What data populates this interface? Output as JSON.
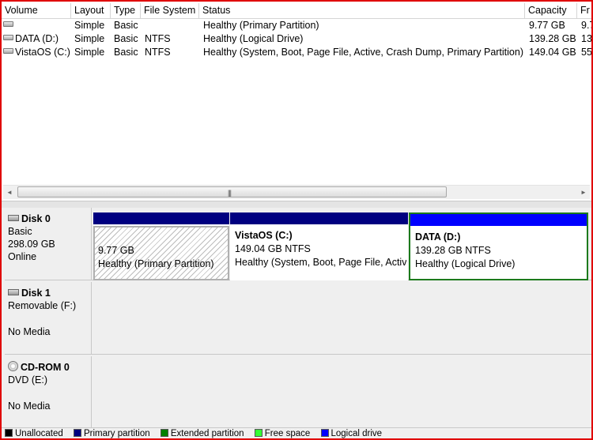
{
  "columns": [
    "Volume",
    "Layout",
    "Type",
    "File System",
    "Status",
    "Capacity",
    "Fr"
  ],
  "volumes": [
    {
      "name": "",
      "layout": "Simple",
      "type": "Basic",
      "fs": "",
      "status": "Healthy (Primary Partition)",
      "capacity": "9.77 GB",
      "free": "9.7"
    },
    {
      "name": "DATA (D:)",
      "layout": "Simple",
      "type": "Basic",
      "fs": "NTFS",
      "status": "Healthy (Logical Drive)",
      "capacity": "139.28 GB",
      "free": "13"
    },
    {
      "name": "VistaOS (C:)",
      "layout": "Simple",
      "type": "Basic",
      "fs": "NTFS",
      "status": "Healthy (System, Boot, Page File, Active, Crash Dump, Primary Partition)",
      "capacity": "149.04 GB",
      "free": "55"
    }
  ],
  "scrollbar": {
    "left_arrow": "◄",
    "right_arrow": "►",
    "grip": "|||"
  },
  "disks": [
    {
      "name": "Disk 0",
      "kind": "Basic",
      "size": "298.09 GB",
      "state": "Online",
      "partitions": [
        {
          "title": "",
          "size_fs": "9.77 GB",
          "status": "Healthy (Primary Partition)",
          "bar_color": "#000080"
        },
        {
          "title": "VistaOS  (C:)",
          "size_fs": "149.04 GB NTFS",
          "status": "Healthy (System, Boot, Page File, Active, Crash Dump, Primary Partition)",
          "bar_color": "#000080"
        },
        {
          "title": "DATA  (D:)",
          "size_fs": "139.28 GB NTFS",
          "status": "Healthy (Logical Drive)",
          "bar_color": "#0000ff"
        }
      ]
    },
    {
      "name": "Disk 1",
      "kind": "Removable (F:)",
      "state": "No Media"
    },
    {
      "name": "CD-ROM 0",
      "kind": "DVD (E:)",
      "state": "No Media"
    }
  ],
  "legend": [
    {
      "label": "Unallocated",
      "color": "#000000"
    },
    {
      "label": "Primary partition",
      "color": "#000080"
    },
    {
      "label": "Extended partition",
      "color": "#008000"
    },
    {
      "label": "Free space",
      "color": "#33ff33"
    },
    {
      "label": "Logical drive",
      "color": "#0000ff"
    }
  ]
}
